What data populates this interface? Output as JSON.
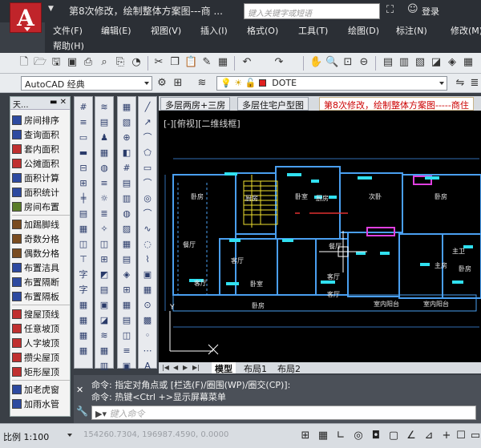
{
  "titlebar": {
    "title": "第8次修改，绘制整体方案图---商 ...",
    "search_placeholder": "键入关键字或短语",
    "login": "登录",
    "logo_letter": "A"
  },
  "menubar": {
    "items": [
      "文件(F)",
      "编辑(E)",
      "视图(V)",
      "插入(I)",
      "格式(O)",
      "工具(T)",
      "绘图(D)",
      "标注(N)",
      "修改(M)",
      "帮助(H)"
    ]
  },
  "toolbar": {
    "workspace": "AutoCAD 经典",
    "layer": "DOTE",
    "layer_color": "#e02020"
  },
  "left_panel": {
    "title": "天...",
    "items": [
      "房间排序",
      "查询面积",
      "套内面积",
      "公摊面积",
      "面积计算",
      "面积统计",
      "房间布置",
      "加踢脚线",
      "奇数分格",
      "偶数分格",
      "布置洁具",
      "布置隔断",
      "布置隔板",
      "搜屋顶线",
      "任意坡顶",
      "人字坡顶",
      "攒尖屋顶",
      "矩形屋顶",
      "加老虎窗",
      "加雨水管"
    ]
  },
  "doc_tabs": [
    "多层两房+三房",
    "多层住宅户型图",
    "第8次修改，绘制整体方案图-----商住"
  ],
  "view_label": "[-][俯视][二维线框]",
  "layout_tabs": [
    "模型",
    "布局1",
    "布局2"
  ],
  "command": {
    "line1": "命令: 指定对角点或 [栏选(F)/圈围(WP)/圈交(CP)]:",
    "line2": "命令: 热键<Ctrl +>显示屏幕菜单",
    "input_placeholder": "键入命令"
  },
  "statusbar": {
    "scale": "比例 1:100",
    "coords": "154260.7304, 196987.4590, 0.0000"
  },
  "rooms": [
    "卧房",
    "厨房",
    "卧室",
    "厨房",
    "次卧",
    "卧房",
    "餐厅",
    "餐厅",
    "客厅",
    "客厅",
    "客厅",
    "卧房",
    "卧室",
    "客厅",
    "主房",
    "主卫",
    "卧房",
    "室内阳台",
    "室内阳台"
  ]
}
